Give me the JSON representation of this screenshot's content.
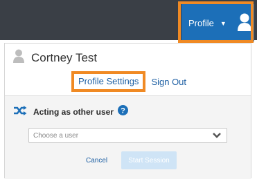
{
  "header": {
    "profile_label": "Profile",
    "caret_icon": "caret-down-icon",
    "avatar_icon": "user-avatar-icon",
    "colors": {
      "bar": "#3a3f46",
      "profile_button": "#1c6fb8",
      "highlight": "#f08a24"
    }
  },
  "menu": {
    "user_name": "Cortney Test",
    "user_icon": "user-avatar-icon",
    "profile_settings": "Profile Settings",
    "sign_out": "Sign Out"
  },
  "acting": {
    "title": "Acting as other user",
    "shuffle_icon": "shuffle-icon",
    "help_icon": "help-circle-icon",
    "select_placeholder": "Choose a user",
    "chevron_icon": "chevron-down-icon",
    "cancel": "Cancel",
    "start_session": "Start Session"
  }
}
